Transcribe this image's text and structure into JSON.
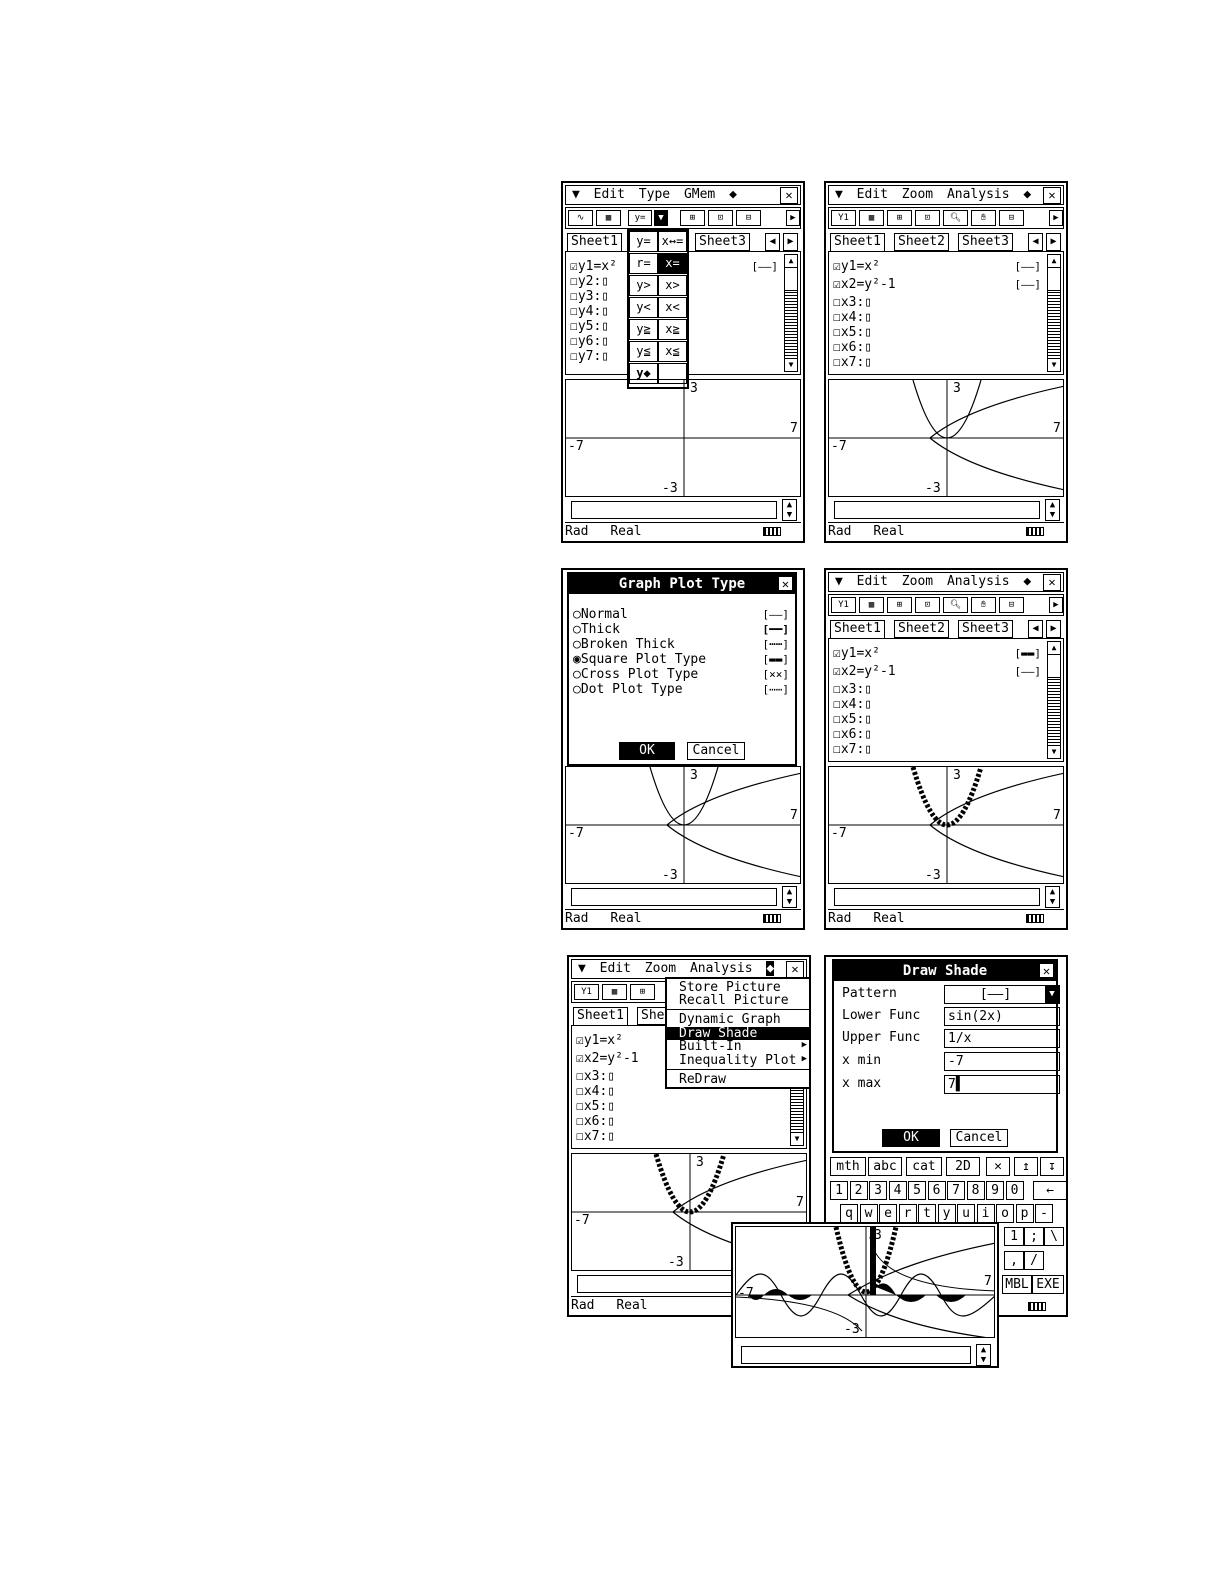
{
  "screens": {
    "s1": {
      "menu": [
        "Edit",
        "Type",
        "GMem"
      ],
      "tabs": [
        "Sheet1",
        "Sheet3"
      ],
      "rows": [
        "y1=x²",
        "y2:▯",
        "y3:▯",
        "y4:▯",
        "y5:▯",
        "y6:▯",
        "y7:▯"
      ],
      "row1_style": "[——]",
      "dropdown": [
        "y=",
        "x↔=",
        "r=",
        "x=",
        "y>",
        "x>",
        "y<",
        "x<",
        "y≧",
        "x≧",
        "y≦",
        "x≦",
        "y◆",
        ""
      ],
      "graph": {
        "ymax": "3",
        "xmax": "7",
        "xmin": "-7",
        "ymin": "-3"
      },
      "status": [
        "Rad",
        "Real"
      ]
    },
    "s2": {
      "menu": [
        "Edit",
        "Zoom",
        "Analysis"
      ],
      "tabs": [
        "Sheet1",
        "Sheet2",
        "Sheet3"
      ],
      "rows": [
        "y1=x²",
        "x2=y²-1",
        "x3:▯",
        "x4:▯",
        "x5:▯",
        "x6:▯",
        "x7:▯"
      ],
      "row_styles": [
        "[——]",
        "[——]"
      ],
      "graph": {
        "ymax": "3",
        "xmax": "7",
        "xmin": "-7",
        "ymin": "-3"
      },
      "status": [
        "Rad",
        "Real"
      ]
    },
    "s3": {
      "dialog_title": "Graph Plot Type",
      "options": [
        "Normal",
        "Thick",
        "Broken Thick",
        "Square Plot Type",
        "Cross Plot Type",
        "Dot Plot Type"
      ],
      "selected_option": "Square Plot Type",
      "ok": "OK",
      "cancel": "Cancel",
      "graph": {
        "ymax": "3",
        "xmax": "7",
        "xmin": "-7",
        "ymin": "-3"
      },
      "status": [
        "Rad",
        "Real"
      ]
    },
    "s4": {
      "menu": [
        "Edit",
        "Zoom",
        "Analysis"
      ],
      "tabs": [
        "Sheet1",
        "Sheet2",
        "Sheet3"
      ],
      "rows": [
        "y1=x²",
        "x2=y²-1",
        "x3:▯",
        "x4:▯",
        "x5:▯",
        "x6:▯",
        "x7:▯"
      ],
      "graph": {
        "ymax": "3",
        "xmax": "7",
        "xmin": "-7",
        "ymin": "-3"
      },
      "status": [
        "Rad",
        "Real"
      ]
    },
    "s5": {
      "menu": [
        "Edit",
        "Zoom",
        "Analysis"
      ],
      "tabs": [
        "Sheet1",
        "She"
      ],
      "rows": [
        "y1=x²",
        "x2=y²-1",
        "x3:▯",
        "x4:▯",
        "x5:▯",
        "x6:▯",
        "x7:▯"
      ],
      "menu_items": [
        "Store Picture",
        "Recall Picture",
        "Dynamic Graph",
        "Draw Shade",
        "Built-In",
        "Inequality Plot",
        "ReDraw"
      ],
      "selected_menu_item": "Draw Shade",
      "graph": {
        "ymax": "3",
        "xmax": "7",
        "xmin": "-7",
        "ymin": "-3"
      },
      "status": [
        "Rad",
        "Real"
      ]
    },
    "s6": {
      "dialog_title": "Draw Shade",
      "fields": [
        {
          "label": "Pattern",
          "value": "[——]"
        },
        {
          "label": "Lower Func",
          "value": "sin(2x)"
        },
        {
          "label": "Upper Func",
          "value": "1/x"
        },
        {
          "label": "x min",
          "value": "-7"
        },
        {
          "label": "x max",
          "value": "7▌"
        }
      ],
      "ok": "OK",
      "cancel": "Cancel",
      "kb_tabs": [
        "mth",
        "abc",
        "cat",
        "2D"
      ],
      "digits": [
        "1",
        "2",
        "3",
        "4",
        "5",
        "6",
        "7",
        "8",
        "9",
        "0",
        "←"
      ],
      "letters": [
        "q",
        "w",
        "e",
        "r",
        "t",
        "y",
        "u",
        "i",
        "o",
        "p",
        "-"
      ],
      "side_keys": [
        "1",
        ";",
        "\\",
        ",",
        "/",
        "MBL",
        "EXE"
      ],
      "status_batt": ""
    },
    "s7": {
      "graph": {
        "ymax": "3",
        "xmax": "7",
        "xmin": "-7",
        "ymin": "-3"
      }
    }
  }
}
